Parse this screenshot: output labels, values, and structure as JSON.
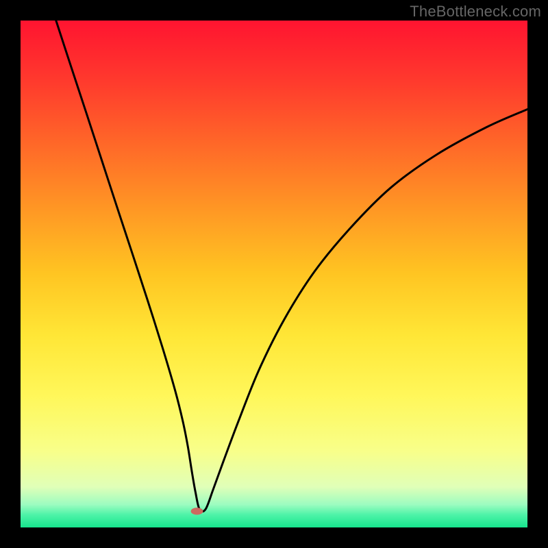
{
  "watermark": "TheBottleneck.com",
  "chart_data": {
    "type": "line",
    "title": "",
    "xlabel": "",
    "ylabel": "",
    "xlim": [
      0,
      100
    ],
    "ylim": [
      0,
      100
    ],
    "grid": false,
    "legend": false,
    "curve": {
      "x": [
        7,
        10,
        13,
        16,
        19,
        22,
        25,
        28,
        30.5,
        32,
        33,
        33.8,
        34.5,
        35.3,
        36.5,
        38,
        40,
        43,
        47,
        52,
        58,
        65,
        73,
        82,
        92,
        100
      ],
      "y": [
        100,
        90.8,
        81.7,
        72.5,
        63.3,
        54.2,
        45,
        35.5,
        27,
        21,
        16,
        11,
        7,
        3.6,
        3.6,
        7.5,
        13,
        21,
        31,
        41,
        50.5,
        59,
        67,
        73.5,
        79,
        82.5
      ]
    },
    "notch": {
      "x": 34.8,
      "y": 3.2,
      "rx": 1.2,
      "ry": 0.7,
      "color": "#ce6a5f"
    },
    "background_gradient": {
      "stops": [
        {
          "offset": 0.0,
          "color": "#ff1430"
        },
        {
          "offset": 0.12,
          "color": "#ff3a2d"
        },
        {
          "offset": 0.25,
          "color": "#ff6a28"
        },
        {
          "offset": 0.38,
          "color": "#ff9a24"
        },
        {
          "offset": 0.5,
          "color": "#ffc522"
        },
        {
          "offset": 0.62,
          "color": "#ffe636"
        },
        {
          "offset": 0.74,
          "color": "#fff75a"
        },
        {
          "offset": 0.85,
          "color": "#f8ff8a"
        },
        {
          "offset": 0.92,
          "color": "#e0ffb8"
        },
        {
          "offset": 0.955,
          "color": "#9cfcc0"
        },
        {
          "offset": 0.975,
          "color": "#4ef3a8"
        },
        {
          "offset": 1.0,
          "color": "#16e58d"
        }
      ]
    }
  }
}
